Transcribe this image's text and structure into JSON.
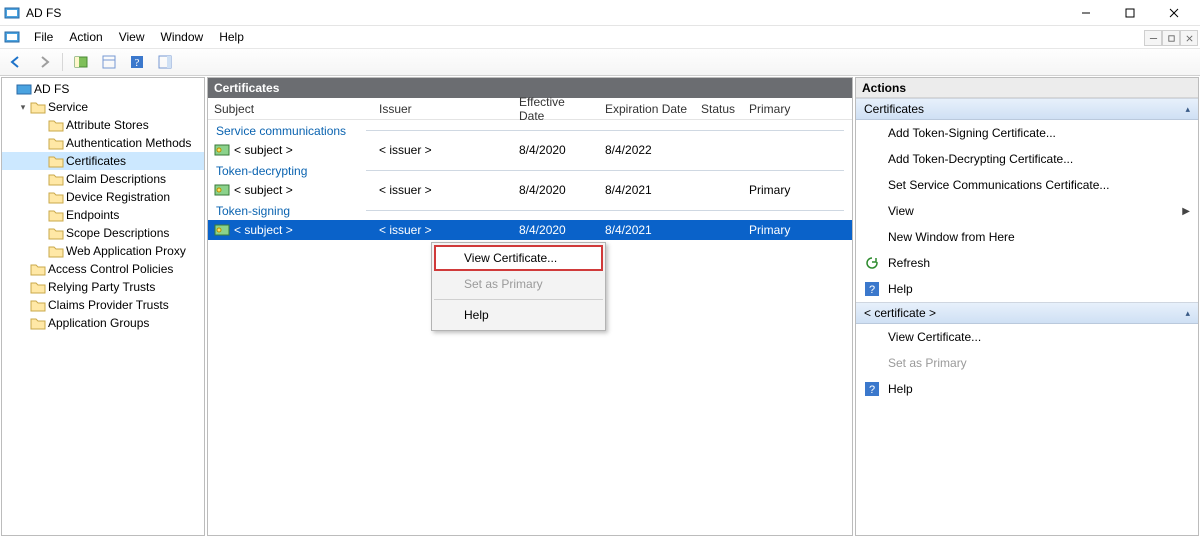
{
  "window": {
    "title": "AD FS"
  },
  "menu": {
    "file": "File",
    "action": "Action",
    "view": "View",
    "window": "Window",
    "help": "Help"
  },
  "tree": {
    "root": "AD FS",
    "service": "Service",
    "service_children": [
      "Attribute Stores",
      "Authentication Methods",
      "Certificates",
      "Claim Descriptions",
      "Device Registration",
      "Endpoints",
      "Scope Descriptions",
      "Web Application Proxy"
    ],
    "siblings": [
      "Access Control Policies",
      "Relying Party Trusts",
      "Claims Provider Trusts",
      "Application Groups"
    ],
    "selected": "Certificates"
  },
  "center": {
    "title": "Certificates",
    "columns": {
      "subject": "Subject",
      "issuer": "Issuer",
      "effective": "Effective Date",
      "expiration": "Expiration Date",
      "status": "Status",
      "primary": "Primary"
    },
    "groups": [
      {
        "name": "Service communications",
        "rows": [
          {
            "subject": "< subject >",
            "issuer": "< issuer >",
            "effective": "8/4/2020",
            "expiration": "8/4/2022",
            "status": "",
            "primary": ""
          }
        ]
      },
      {
        "name": "Token-decrypting",
        "rows": [
          {
            "subject": "< subject >",
            "issuer": "< issuer >",
            "effective": "8/4/2020",
            "expiration": "8/4/2021",
            "status": "",
            "primary": "Primary"
          }
        ]
      },
      {
        "name": "Token-signing",
        "rows": [
          {
            "subject": "< subject >",
            "issuer": "< issuer >",
            "effective": "8/4/2020",
            "expiration": "8/4/2021",
            "status": "",
            "primary": "Primary",
            "selected": true
          }
        ]
      }
    ]
  },
  "context_menu": {
    "view_certificate": "View Certificate...",
    "set_as_primary": "Set as Primary",
    "help": "Help"
  },
  "actions": {
    "title": "Actions",
    "section1": {
      "header": "Certificates",
      "items": {
        "add_token_signing": "Add Token-Signing Certificate...",
        "add_token_decrypting": "Add Token-Decrypting Certificate...",
        "set_service_comm": "Set Service Communications Certificate...",
        "view": "View",
        "new_window": "New Window from Here",
        "refresh": "Refresh",
        "help": "Help"
      }
    },
    "section2": {
      "header": "< certificate >",
      "items": {
        "view_certificate": "View Certificate...",
        "set_as_primary": "Set as Primary",
        "help": "Help"
      }
    }
  }
}
